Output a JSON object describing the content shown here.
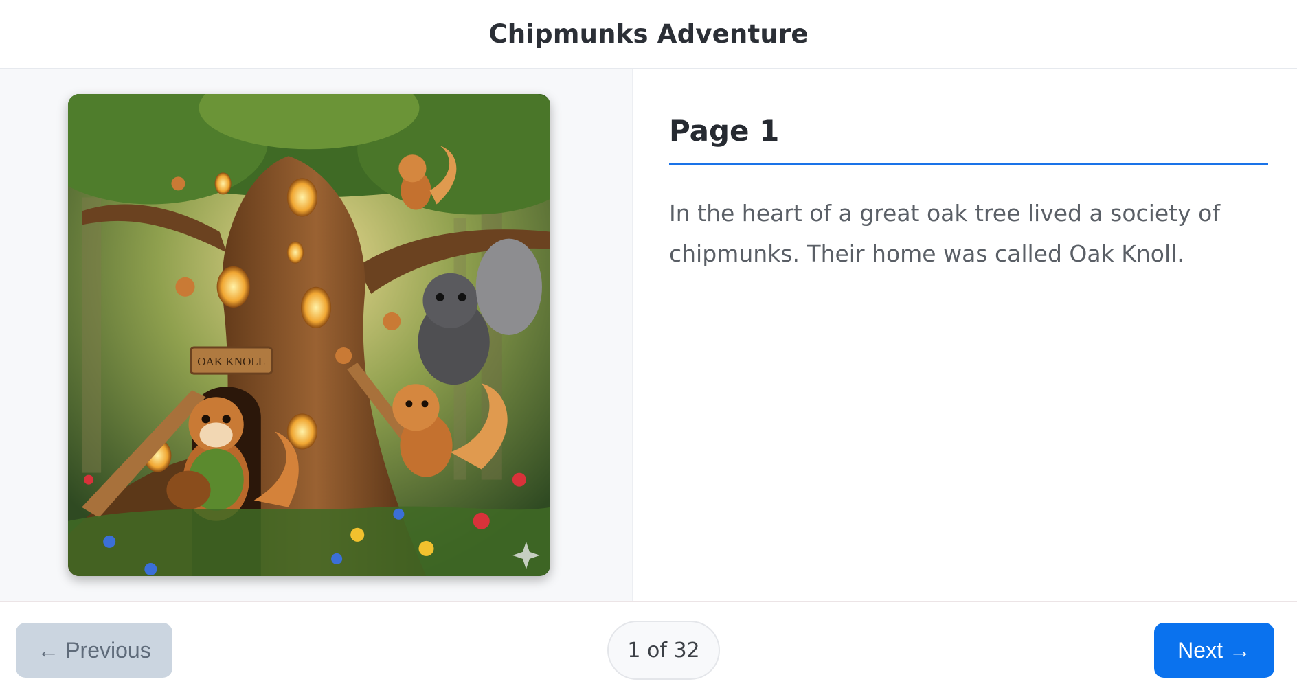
{
  "app": {
    "title": "Chipmunks Adventure"
  },
  "page": {
    "heading": "Page 1",
    "text": "In the heart of a great oak tree lived a society of chipmunks. Their home was called Oak Knoll.",
    "illustration": {
      "sign_text": "OAK KNOLL"
    }
  },
  "navigation": {
    "previous_label": "← Previous",
    "next_label": "Next →",
    "counter": "1 of 32",
    "current_page": 1,
    "total_pages": 32
  },
  "colors": {
    "accent": "#1a73e8",
    "next_button": "#0a72ee",
    "previous_button": "#cbd5e0"
  }
}
